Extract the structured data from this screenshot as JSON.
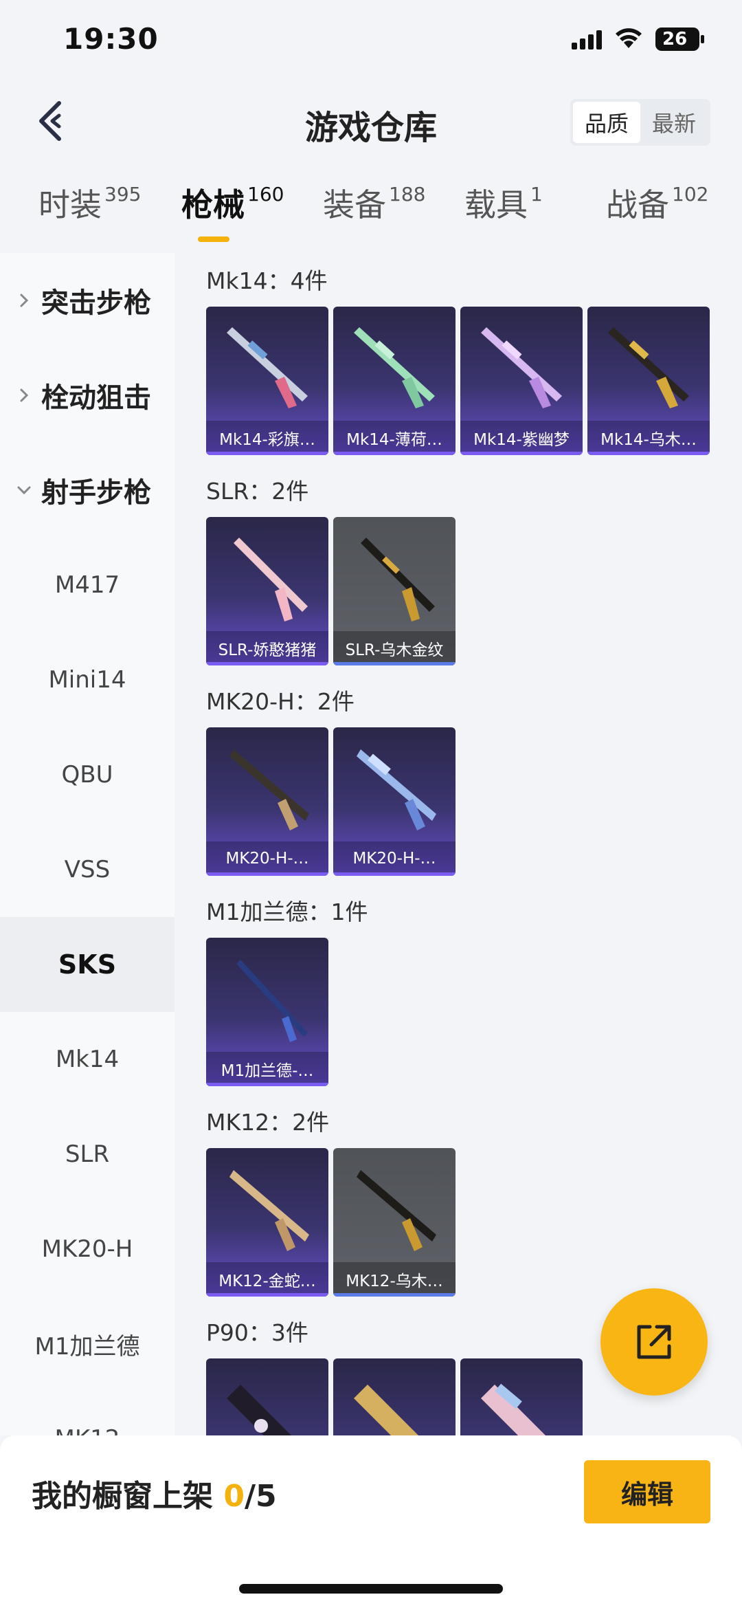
{
  "status_bar": {
    "time": "19:30",
    "battery": "26"
  },
  "header": {
    "title": "游戏仓库",
    "sort_options": [
      "品质",
      "最新"
    ],
    "active_sort": "品质"
  },
  "tabs": [
    {
      "label": "时装",
      "count": "395"
    },
    {
      "label": "枪械",
      "count": "160",
      "active": true
    },
    {
      "label": "装备",
      "count": "188"
    },
    {
      "label": "载具",
      "count": "1"
    },
    {
      "label": "战备",
      "count": "102"
    }
  ],
  "sidebar": {
    "categories": [
      "突击步枪",
      "栓动狙击",
      "射手步枪"
    ],
    "items": [
      "M417",
      "Mini14",
      "QBU",
      "VSS",
      "SKS",
      "Mk14",
      "SLR",
      "MK20-H",
      "M1加兰德",
      "MK12"
    ],
    "selected": "SKS"
  },
  "groups": [
    {
      "title": "Mk14：4件",
      "items": [
        "Mk14-彩旗…",
        "Mk14-薄荷…",
        "Mk14-紫幽梦",
        "Mk14-乌木…"
      ]
    },
    {
      "title": "SLR：2件",
      "items": [
        "SLR-娇憨猪猪",
        "SLR-乌木金纹"
      ]
    },
    {
      "title": "MK20-H：2件",
      "items": [
        "MK20-H-…",
        "MK20-H-…"
      ]
    },
    {
      "title": "M1加兰德：1件",
      "items": [
        "M1加兰德-…"
      ]
    },
    {
      "title": "MK12：2件",
      "items": [
        "MK12-金蛇…",
        "MK12-乌木…"
      ]
    },
    {
      "title": "P90：3件",
      "items": [
        "",
        "",
        ""
      ]
    }
  ],
  "bottom_bar": {
    "label": "我的橱窗上架",
    "current": "0",
    "total": "/5",
    "edit_label": "编辑"
  },
  "colors": {
    "accent": "#f5b10c",
    "card_purple": "#3b3570",
    "card_grey": "#5a5d63"
  }
}
